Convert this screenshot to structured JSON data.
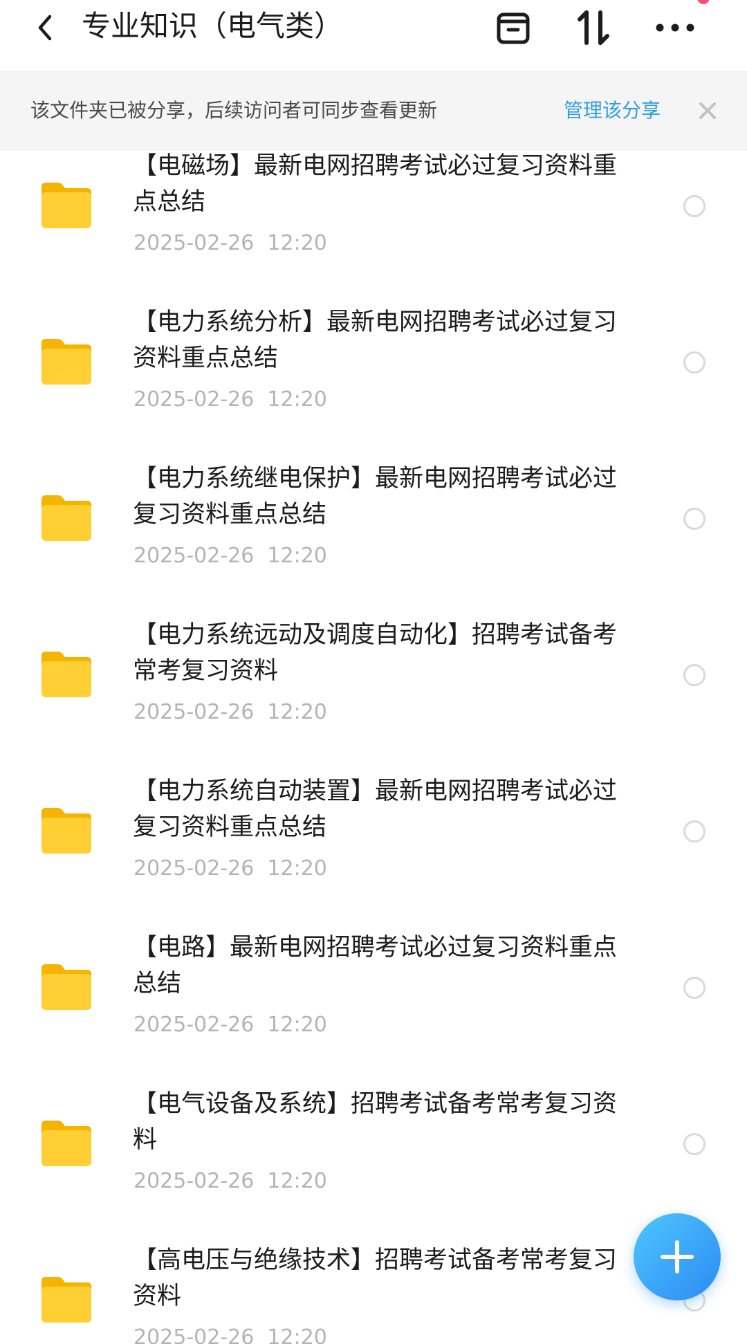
{
  "header": {
    "title": "专业知识（电气类）",
    "icons": [
      "back-arrow-icon",
      "inbox-icon",
      "sort-icon",
      "more-icon"
    ]
  },
  "banner": {
    "text": "该文件夹已被分享，后续访问者可同步查看更新",
    "link": "管理该分享",
    "link_color": "#2f9fdf"
  },
  "items": [
    {
      "title": "【电磁场】最新电网招聘考试必过复习资料重点总结",
      "date": "2025-02-26  12:20"
    },
    {
      "title": "【电力系统分析】最新电网招聘考试必过复习资料重点总结",
      "date": "2025-02-26  12:20"
    },
    {
      "title": "【电力系统继电保护】最新电网招聘考试必过复习资料重点总结",
      "date": "2025-02-26  12:20"
    },
    {
      "title": "【电力系统远动及调度自动化】招聘考试备考常考复习资料",
      "date": "2025-02-26  12:20"
    },
    {
      "title": "【电力系统自动装置】最新电网招聘考试必过复习资料重点总结",
      "date": "2025-02-26  12:20"
    },
    {
      "title": "【电路】最新电网招聘考试必过复习资料重点总结",
      "date": "2025-02-26  12:20"
    },
    {
      "title": "【电气设备及系统】招聘考试备考常考复习资料",
      "date": "2025-02-26  12:20"
    },
    {
      "title": "【高电压与绝缘技术】招聘考试备考常考复习资料",
      "date": "2025-02-26  12:20"
    }
  ],
  "colors": {
    "folder": "#ffc928",
    "fab": "#2b8bf2",
    "notification_dot": "#f5506e"
  }
}
